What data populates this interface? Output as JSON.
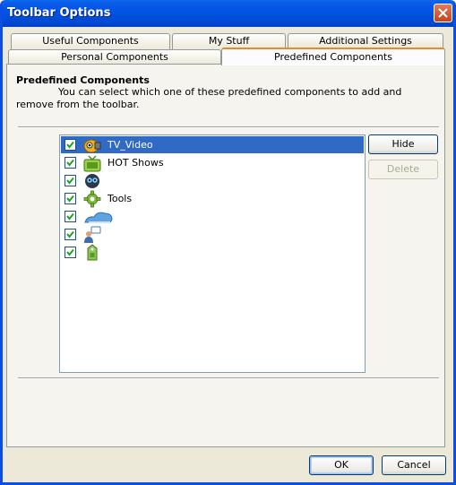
{
  "window": {
    "title": "Toolbar Options"
  },
  "tabs": {
    "row1": [
      "Useful Components",
      "My Stuff",
      "Additional Settings"
    ],
    "row2": [
      "Personal Components",
      "Predefined Components"
    ],
    "active": "Predefined Components"
  },
  "section": {
    "title": "Predefined Components",
    "description": "You can select which one of these predefined components to add and remove from the toolbar."
  },
  "components": [
    {
      "label": "TV_Video",
      "icon": "tv-video-icon",
      "checked": true,
      "selected": true
    },
    {
      "label": "HOT Shows",
      "icon": "hot-shows-tv-icon",
      "checked": true,
      "selected": false
    },
    {
      "label": "",
      "icon": "blue-alien-icon",
      "checked": true,
      "selected": false
    },
    {
      "label": "Tools",
      "icon": "gear-icon",
      "checked": true,
      "selected": false
    },
    {
      "label": "",
      "icon": "cloud-icon",
      "checked": true,
      "selected": false
    },
    {
      "label": "",
      "icon": "user-chat-icon",
      "checked": true,
      "selected": false
    },
    {
      "label": "",
      "icon": "green-tag-icon",
      "checked": true,
      "selected": false
    }
  ],
  "buttons": {
    "hide": "Hide",
    "delete": "Delete",
    "ok": "OK",
    "cancel": "Cancel"
  },
  "colors": {
    "titlebar": "#0054e3",
    "selection": "#316ac5",
    "active_tab_accent": "#e68b2c",
    "dialog_bg": "#ece9d8"
  }
}
